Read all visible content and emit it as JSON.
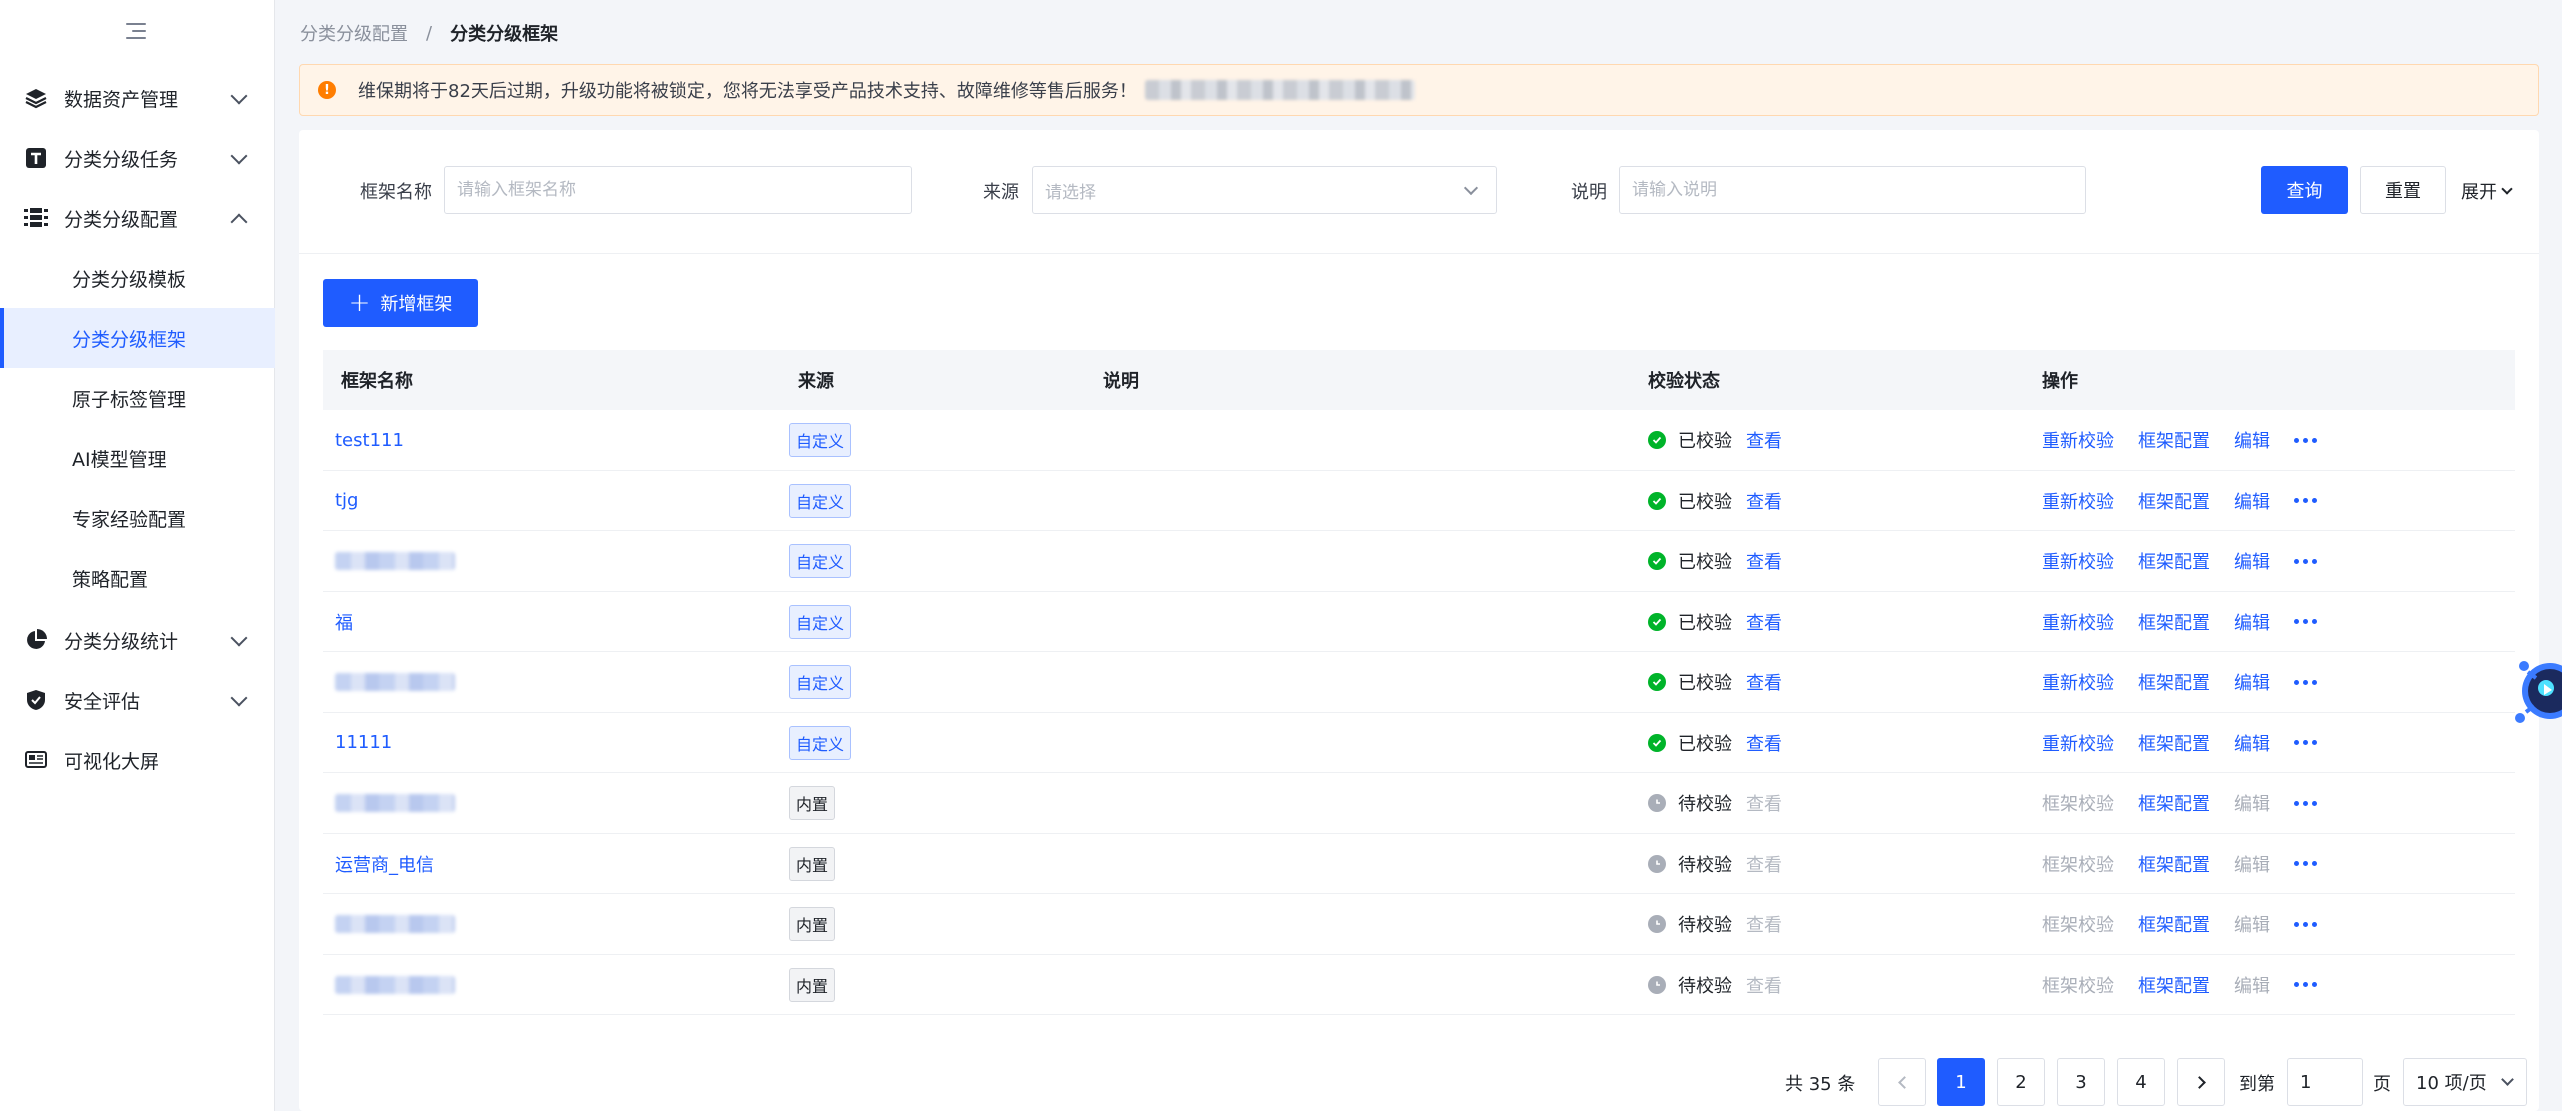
{
  "sidebar": {
    "items": [
      {
        "label": "数据资产管理",
        "icon": "layers-icon"
      },
      {
        "label": "分类分级任务",
        "icon": "task-icon"
      },
      {
        "label": "分类分级配置",
        "icon": "list-config-icon"
      },
      {
        "label": "分类分级统计",
        "icon": "pie-chart-icon"
      },
      {
        "label": "安全评估",
        "icon": "shield-icon"
      },
      {
        "label": "可视化大屏",
        "icon": "dashboard-icon"
      }
    ],
    "sub_items": [
      {
        "label": "分类分级模板"
      },
      {
        "label": "分类分级框架"
      },
      {
        "label": "原子标签管理"
      },
      {
        "label": "AI模型管理"
      },
      {
        "label": "专家经验配置"
      },
      {
        "label": "策略配置"
      }
    ]
  },
  "breadcrumb": {
    "parent": "分类分级配置",
    "separator": "/",
    "current": "分类分级框架"
  },
  "notice": {
    "text": "维保期将于82天后过期，升级功能将被锁定，您将无法享受产品技术支持、故障维修等售后服务！"
  },
  "filters": {
    "name_label": "框架名称",
    "name_placeholder": "请输入框架名称",
    "source_label": "来源",
    "source_placeholder": "请选择",
    "desc_label": "说明",
    "desc_placeholder": "请输入说明",
    "query_label": "查询",
    "reset_label": "重置",
    "expand_label": "展开"
  },
  "add_button": {
    "label": "新增框架"
  },
  "table": {
    "columns": [
      "框架名称",
      "来源",
      "说明",
      "校验状态",
      "操作"
    ],
    "view_label": "查看",
    "rows": [
      {
        "name": "test111",
        "blurred": false,
        "source": "自定义",
        "status": "已校验",
        "verified": true,
        "op1": "重新校验",
        "op2": "框架配置",
        "op3": "编辑"
      },
      {
        "name": "tjg",
        "blurred": false,
        "source": "自定义",
        "status": "已校验",
        "verified": true,
        "op1": "重新校验",
        "op2": "框架配置",
        "op3": "编辑"
      },
      {
        "name": "",
        "blurred": true,
        "source": "自定义",
        "status": "已校验",
        "verified": true,
        "op1": "重新校验",
        "op2": "框架配置",
        "op3": "编辑"
      },
      {
        "name": "福",
        "blurred": false,
        "source": "自定义",
        "status": "已校验",
        "verified": true,
        "op1": "重新校验",
        "op2": "框架配置",
        "op3": "编辑"
      },
      {
        "name": "",
        "blurred": true,
        "source": "自定义",
        "status": "已校验",
        "verified": true,
        "op1": "重新校验",
        "op2": "框架配置",
        "op3": "编辑"
      },
      {
        "name": "11111",
        "blurred": false,
        "source": "自定义",
        "status": "已校验",
        "verified": true,
        "op1": "重新校验",
        "op2": "框架配置",
        "op3": "编辑"
      },
      {
        "name": "",
        "blurred": true,
        "source": "内置",
        "status": "待校验",
        "verified": false,
        "op1": "框架校验",
        "op2": "框架配置",
        "op3": "编辑"
      },
      {
        "name": "运营商_电信",
        "blurred": false,
        "source": "内置",
        "status": "待校验",
        "verified": false,
        "op1": "框架校验",
        "op2": "框架配置",
        "op3": "编辑"
      },
      {
        "name": "",
        "blurred": true,
        "source": "内置",
        "status": "待校验",
        "verified": false,
        "op1": "框架校验",
        "op2": "框架配置",
        "op3": "编辑"
      },
      {
        "name": "",
        "blurred": true,
        "source": "内置",
        "status": "待校验",
        "verified": false,
        "op1": "框架校验",
        "op2": "框架配置",
        "op3": "编辑"
      }
    ]
  },
  "pagination": {
    "total_text": "共 35 条",
    "pages": [
      "1",
      "2",
      "3",
      "4"
    ],
    "current_page": "1",
    "goto_label": "到第",
    "goto_value": "1",
    "page_unit": "页",
    "page_size": "10 项/页"
  },
  "colors": {
    "primary": "#1f5cff",
    "success": "#00b42a",
    "warning": "#ff7d00",
    "muted": "#a9aeb8"
  }
}
